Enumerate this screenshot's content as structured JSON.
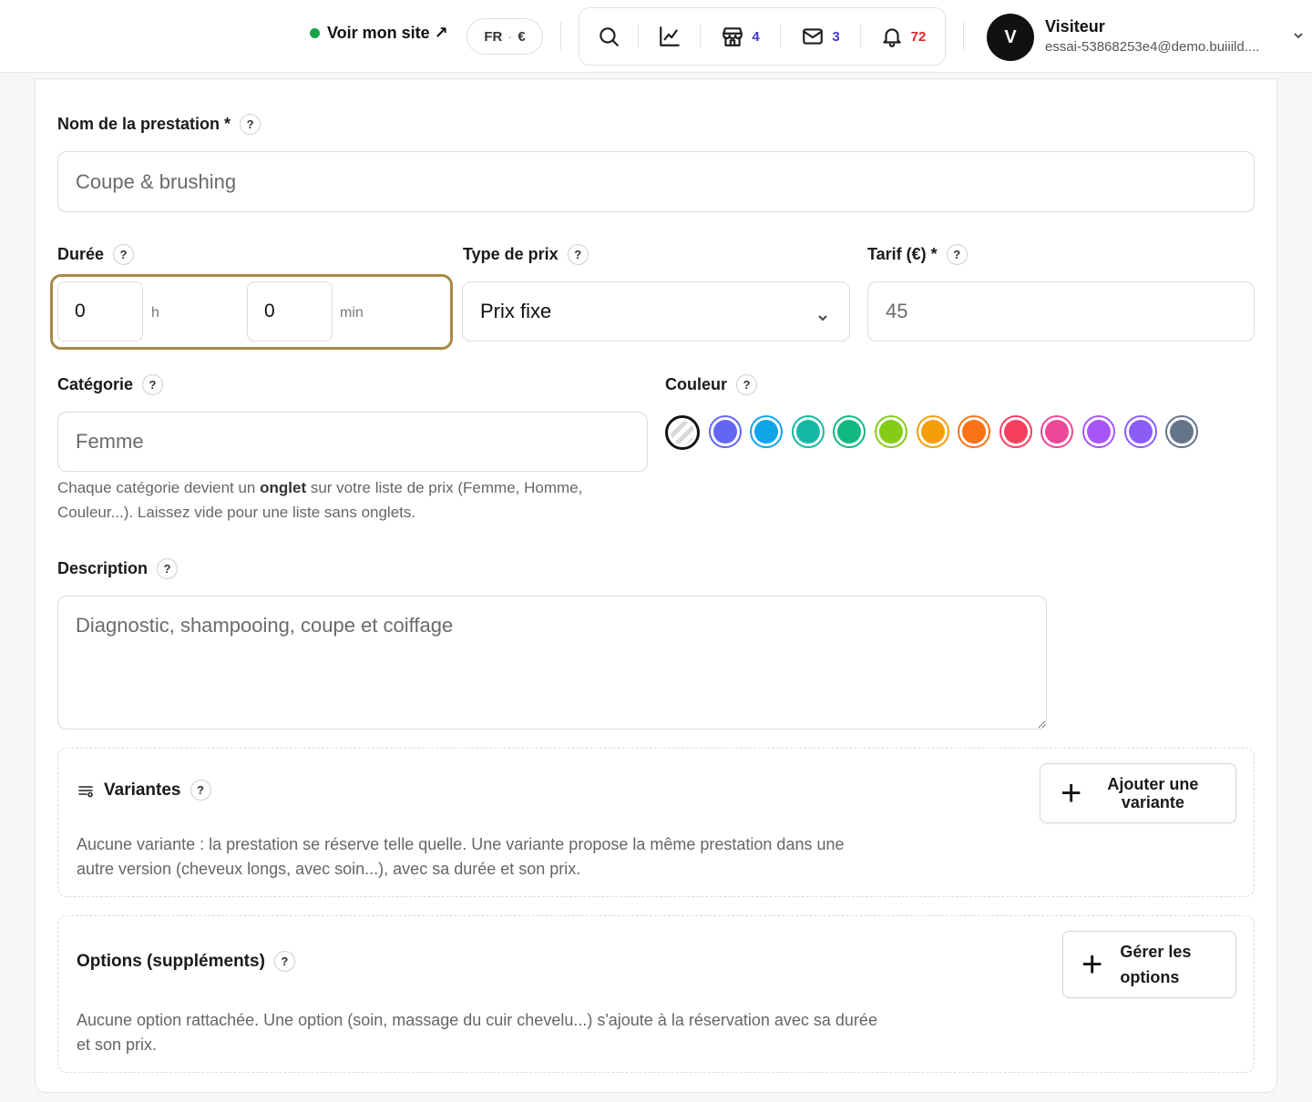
{
  "topbar": {
    "site_link": "Voir mon site ↗",
    "lang": "FR",
    "currency": "€",
    "badges": {
      "shop": "4",
      "mail": "3",
      "notifications": "72"
    },
    "badge_colors": {
      "shop": "#4338ca",
      "mail": "#4338ca",
      "notifications": "#dc2626"
    },
    "user": {
      "initial": "V",
      "name": "Visiteur",
      "email": "essai-53868253e4@demo.buiiild...."
    }
  },
  "form": {
    "name": {
      "label": "Nom de la prestation *",
      "placeholder": "Coupe & brushing"
    },
    "duration": {
      "label": "Durée",
      "hours": "0",
      "hours_unit": "h",
      "minutes": "0",
      "minutes_unit": "min"
    },
    "price_type": {
      "label": "Type de prix",
      "value": "Prix fixe"
    },
    "tarif": {
      "label": "Tarif (€) *",
      "placeholder": "45"
    },
    "category": {
      "label": "Catégorie",
      "placeholder": "Femme",
      "hint_before": "Chaque catégorie devient un ",
      "hint_bold": "onglet",
      "hint_after": " sur votre liste de prix (Femme, Homme, Couleur...). Laissez vide pour une liste sans onglets."
    },
    "color": {
      "label": "Couleur",
      "swatches": [
        "none",
        "#6366f1",
        "#0ea5e9",
        "#14b8a6",
        "#10b981",
        "#84cc16",
        "#f59e0b",
        "#f97316",
        "#f43f5e",
        "#ec4899",
        "#a855f7",
        "#8b5cf6",
        "#64748b"
      ]
    },
    "description": {
      "label": "Description",
      "placeholder": "Diagnostic, shampooing, coupe et coiffage"
    }
  },
  "variants": {
    "title": "Variantes",
    "button_line1": "Ajouter une",
    "button_line2": "variante",
    "description": "Aucune variante : la prestation se réserve telle quelle. Une variante propose la même prestation dans une autre version (cheveux longs, avec soin...), avec sa durée et son prix."
  },
  "options": {
    "title": "Options (suppléments)",
    "button_line1": "Gérer les",
    "button_line2": "options",
    "description": "Aucune option rattachée. Une option (soin, massage du cuir chevelu...) s'ajoute à la réservation avec sa durée et son prix."
  },
  "help_mark": "?"
}
